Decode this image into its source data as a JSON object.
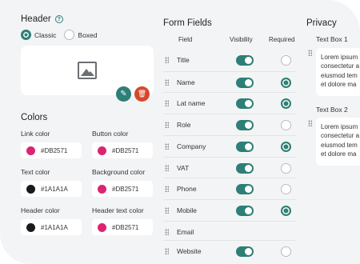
{
  "header": {
    "title": "Header",
    "layout_options": [
      {
        "label": "Classic",
        "selected": true
      },
      {
        "label": "Boxed",
        "selected": false
      }
    ]
  },
  "colors": {
    "title": "Colors",
    "fields": [
      {
        "label": "Link color",
        "value": "#DB2571",
        "swatch": "#DB2571"
      },
      {
        "label": "Button color",
        "value": "#DB2571",
        "swatch": "#DB2571"
      },
      {
        "label": "Text color",
        "value": "#1A1A1A",
        "swatch": "#1A1A1A"
      },
      {
        "label": "Background color",
        "value": "#DB2571",
        "swatch": "#DB2571"
      },
      {
        "label": "Header color",
        "value": "#1A1A1A",
        "swatch": "#1A1A1A"
      },
      {
        "label": "Header text color",
        "value": "#DB2571",
        "swatch": "#DB2571"
      }
    ]
  },
  "form_fields": {
    "title": "Form Fields",
    "columns": {
      "field": "Field",
      "visibility": "Visibility",
      "required": "Required"
    },
    "rows": [
      {
        "label": "Title",
        "visible": true,
        "required": false
      },
      {
        "label": "Name",
        "visible": true,
        "required": true
      },
      {
        "label": "Lat name",
        "visible": true,
        "required": true
      },
      {
        "label": "Role",
        "visible": true,
        "required": false
      },
      {
        "label": "Company",
        "visible": true,
        "required": true
      },
      {
        "label": "VAT",
        "visible": true,
        "required": false
      },
      {
        "label": "Phone",
        "visible": true,
        "required": false
      },
      {
        "label": "Mobile",
        "visible": true,
        "required": true
      },
      {
        "label": "Email",
        "visible": null,
        "required": null
      },
      {
        "label": "Website",
        "visible": true,
        "required": false
      }
    ]
  },
  "privacy": {
    "title": "Privacy",
    "text_boxes": [
      {
        "label": "Text Box 1",
        "lines": [
          "Lorem ipsum",
          "consectetur a",
          "eiusmod tem",
          "et dolore ma"
        ]
      },
      {
        "label": "Text Box 2",
        "lines": [
          "Lorem ipsum",
          "consectetur a",
          "eiusmod tem",
          "et dolore ma"
        ]
      }
    ]
  },
  "accent_color": "#2E7F76",
  "delete_color": "#D6482B"
}
